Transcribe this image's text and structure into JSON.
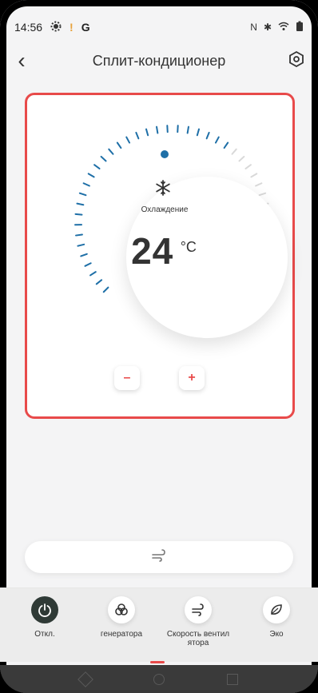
{
  "status_bar": {
    "time": "14:56",
    "left_icons": [
      "gear-icon",
      "warning-icon",
      "google-icon"
    ],
    "right_icons": [
      "nfc-icon",
      "bluetooth-icon",
      "wifi-icon",
      "battery-icon"
    ]
  },
  "header": {
    "title": "Сплит-кондиционер",
    "back_icon": "chevron-left-icon",
    "settings_icon": "settings-hex-icon"
  },
  "thermostat": {
    "mode_label": "Охлаждение",
    "temperature": "24",
    "unit": "°C",
    "mode_icon": "snowflake-icon",
    "minus_label": "–",
    "plus_label": "+"
  },
  "bottom_pill": {
    "icon": "fan-wind-icon"
  },
  "bottom_nav": [
    {
      "label": "Откл.",
      "icon": "power-icon"
    },
    {
      "label": "генератора",
      "icon": "generator-icon"
    },
    {
      "label": "Скорость вентил ятора",
      "icon": "wind-icon"
    },
    {
      "label": "Эко",
      "icon": "leaf-icon"
    }
  ],
  "colors": {
    "accent_red": "#e84a4a",
    "dial_blue": "#1e6fa7"
  }
}
